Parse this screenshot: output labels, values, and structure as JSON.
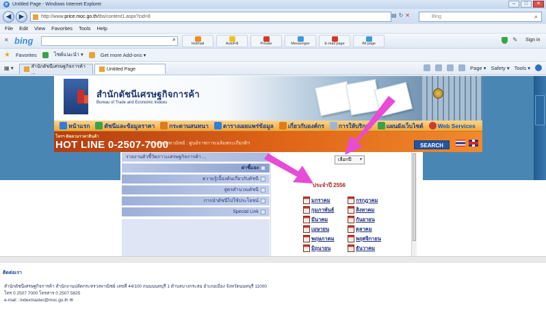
{
  "window": {
    "title": "Untitled Page - Windows Internet Explorer",
    "controls": [
      "–",
      "□",
      "✕"
    ]
  },
  "address_bar": {
    "url_prefix": "http://www.",
    "url_host": "price.moc.go.th",
    "url_rest": "/tbs/content1.aspx?cid=8",
    "search_placeholder": "Bing"
  },
  "menu": [
    "File",
    "Edit",
    "View",
    "Favorites",
    "Tools",
    "Help"
  ],
  "bing_toolbar": {
    "logo": "bing",
    "buttons": [
      {
        "label": "Hotmail",
        "color": "#f08a1c"
      },
      {
        "label": "AutoFill",
        "color": "#f2c21a"
      },
      {
        "label": "Private",
        "color": "#d03a2a"
      },
      {
        "label": "Messenger",
        "color": "#3a9ad9"
      },
      {
        "label": "E-mail page",
        "color": "#d03a2a"
      },
      {
        "label": "IM page",
        "color": "#3a9ad9"
      }
    ],
    "sign_in": "Sign in"
  },
  "favorites_bar": {
    "favorites": "Favorites",
    "links": [
      "ไซต์แนะนำ ▾",
      "Get more Add-ons ▾"
    ]
  },
  "tabs": {
    "items": [
      "สำนักดัชนีเศรษฐกิจการค้า ...",
      "Untitled Page"
    ],
    "commands": [
      "Page ▾",
      "Safety ▾",
      "Tools ▾"
    ]
  },
  "banner": {
    "title_th": "สำนักดัชนีเศรษฐกิจการค้า",
    "title_en": "Bureau of Trade and Economic Indices"
  },
  "nav": [
    {
      "label": "หน้าแรก",
      "color": "#2f7ed8"
    },
    {
      "label": "ดัชนีและข้อมูลราคา",
      "color": "#3aa24a"
    },
    {
      "label": "กระดานสนทนา",
      "color": "#e07a1c"
    },
    {
      "label": "ตารางเผยแพร่ข้อมูล",
      "color": "#2f7ed8"
    },
    {
      "label": "เกี่ยวกับองค์กร",
      "color": "#e07a1c"
    },
    {
      "label": "การให้บริการ",
      "color": "#9bb6d8"
    },
    {
      "label": "แผนผังเว็บไซต์",
      "color": "#3aa24a"
    },
    {
      "label": "Web Services",
      "color": "#d03a2a"
    }
  ],
  "hotline": {
    "small": "โทรฯ ติดตามราคาสินค้า",
    "big": "HOT LINE 0-2507-7000",
    "marquee": "กระทรวงพาณิชย์ : ศูนย์ราชการเฉลิมพระเกียรติฯ",
    "search": "SEARCH"
  },
  "left_menu": [
    {
      "label": "รายงานตัวชี้วัดภาวะเศรษฐกิจการค้า ...",
      "style": "top"
    },
    {
      "label": "ค่าชี้แจง",
      "style": "dark"
    },
    {
      "label": "ความรู้เบื้องต้นเกี่ยวกับดัชนี",
      "style": "normal"
    },
    {
      "label": "สูตรคำนวณดัชนี",
      "style": "normal"
    },
    {
      "label": "การนำดัชนีไปใช้ประโยชน์",
      "style": "normal"
    },
    {
      "label": "Special Link",
      "style": "normal"
    }
  ],
  "index_frame": {
    "select_value": "เลือกปี",
    "year_title": "ประจำปี 2556",
    "months": [
      "มกราคม",
      "กรกฎาคม",
      "กุมภาพันธ์",
      "สิงหาคม",
      "มีนาคม",
      "กันยายน",
      "เมษายน",
      "ตุลาคม",
      "พฤษภาคม",
      "พฤศจิกายน",
      "มิถุนายน",
      "ธันวาคม"
    ]
  },
  "footer": {
    "heading": "ติดต่อเรา",
    "address": "สำนักดัชนีเศรษฐกิจการค้า สำนักงานปลัดกระทรวงพาณิชย์ เลขที่ 44/100 ถนนนนทบุรี 1 ตำบลบางกระสอ อำเภอเมือง จังหวัดนนทบุรี 11000",
    "phone": "โทร 0 2507 7000 โทรสาร 0 2507 5825",
    "email": "e-mail : indexmaster@moc.go.th"
  },
  "colors": {
    "arrow": "#e84bd6",
    "nav_bg": "#f0a83c",
    "hotline_bg": "#e06618",
    "side_panel": "#4a86b4"
  }
}
